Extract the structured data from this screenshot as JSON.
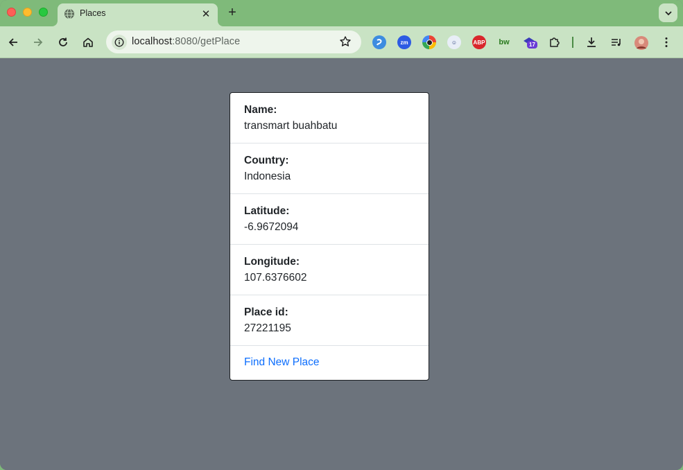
{
  "browser": {
    "tab_title": "Places",
    "url_host": "localhost",
    "url_rest": ":8080/getPlace",
    "profile_badge": "17"
  },
  "place": {
    "fields": [
      {
        "label": "Name:",
        "value": "transmart buahbatu"
      },
      {
        "label": "Country:",
        "value": "Indonesia"
      },
      {
        "label": "Latitude:",
        "value": "-6.9672094"
      },
      {
        "label": "Longitude:",
        "value": "107.6376602"
      },
      {
        "label": "Place id:",
        "value": "27221195"
      }
    ],
    "action_link": "Find New Place"
  },
  "colors": {
    "page_bg": "#6c737c",
    "link": "#0d6efd",
    "chrome_frame": "#7fba7a",
    "chrome_toolbar": "#c9e3c4"
  }
}
